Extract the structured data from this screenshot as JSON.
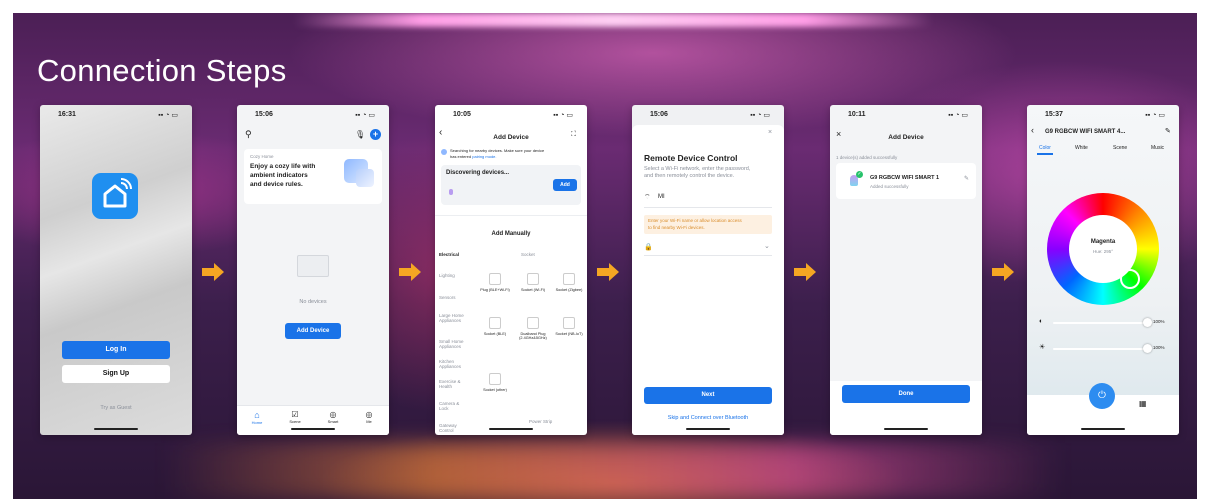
{
  "title": "Connection Steps",
  "accent": "#f5a623",
  "brand_blue": "#1a73e8",
  "phone1": {
    "time": "16:31",
    "login": "Log In",
    "signup": "Sign Up",
    "guest": "Try as Guest"
  },
  "phone2": {
    "time": "15:06",
    "card_small": "Cozy Home",
    "card_title_l1": "Enjoy a cozy life with",
    "card_title_l2": "ambient indicators",
    "card_title_l3": "and device rules.",
    "no_devices": "No devices",
    "add_device": "Add Device",
    "tabs": [
      "Home",
      "Scene",
      "Smart",
      "Me"
    ]
  },
  "phone3": {
    "time": "10:05",
    "header": "Add Device",
    "searching_l1": "Searching for nearby devices. Make sure your device",
    "searching_l2": "has entered",
    "pairing_link": "pairing mode.",
    "discovering": "Discovering devices...",
    "add": "Add",
    "add_manually": "Add Manually",
    "col_left": "Electrical",
    "col_right": "Socket",
    "categories": [
      "Lighting",
      "Sensors",
      "Large Home Appliances",
      "Small Home Appliances",
      "Kitchen Appliances",
      "Exercise & Health",
      "Camera & Lock",
      "Gateway Control"
    ],
    "row1": [
      "Plug (BLE+Wi-Fi)",
      "Socket (Wi-Fi)",
      "Socket (Zigbee)"
    ],
    "row2": [
      "Socket (BLE)",
      "Dualband Plug (2.4GHz&5GHz)",
      "Socket (NB-IoT)"
    ],
    "row3": [
      "Socket (other)"
    ],
    "power_strip": "Power Strip"
  },
  "phone4": {
    "time": "15:06",
    "header": "Remote Device Control",
    "desc_l1": "Select a Wi-Fi network, enter the password,",
    "desc_l2": "and then remotely control the device.",
    "wifi_name": "MI",
    "warn_l1": "Enter your Wi-Fi name or allow location access",
    "warn_l2": "to find nearby Wi-Fi devices.",
    "next": "Next",
    "skip": "Skip and Connect over Bluetooth"
  },
  "phone5": {
    "time": "10:11",
    "header": "Add Device",
    "added_count": "1 device(s) added successfully",
    "device_name": "G9 RGBCW WIFI SMART 1",
    "device_status": "Added successfully",
    "done": "Done"
  },
  "phone6": {
    "time": "15:37",
    "header": "G9 RGBCW WIFI SMART 4...",
    "tabs": [
      "Color",
      "White",
      "Scene",
      "Music"
    ],
    "color_name": "Magenta",
    "hue": "Hue: 295°",
    "brightness": "100%",
    "saturation": "100%"
  }
}
